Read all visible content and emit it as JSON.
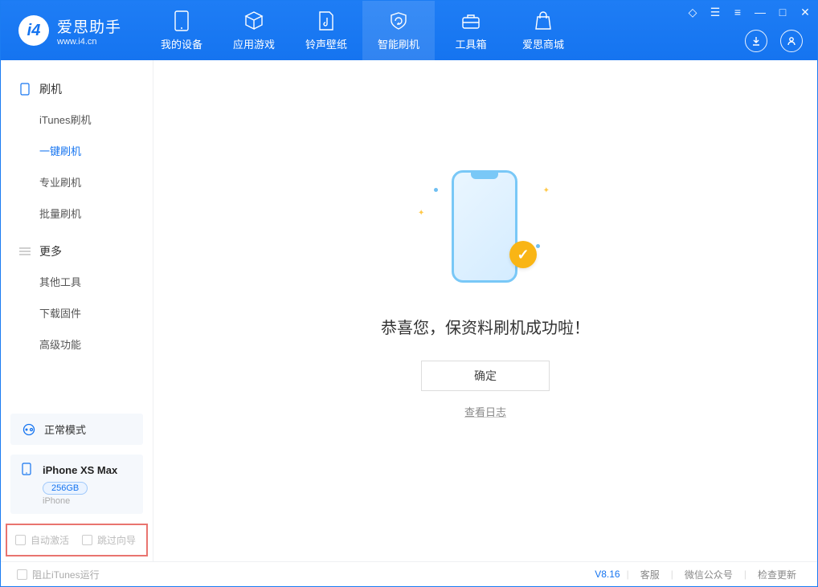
{
  "app": {
    "title": "爱思助手",
    "subtitle": "www.i4.cn"
  },
  "nav": {
    "items": [
      {
        "label": "我的设备"
      },
      {
        "label": "应用游戏"
      },
      {
        "label": "铃声壁纸"
      },
      {
        "label": "智能刷机"
      },
      {
        "label": "工具箱"
      },
      {
        "label": "爱思商城"
      }
    ]
  },
  "sidebar": {
    "section1_title": "刷机",
    "section1_items": [
      "iTunes刷机",
      "一键刷机",
      "专业刷机",
      "批量刷机"
    ],
    "section2_title": "更多",
    "section2_items": [
      "其他工具",
      "下载固件",
      "高级功能"
    ],
    "mode_card": "正常模式",
    "device": {
      "name": "iPhone XS Max",
      "capacity": "256GB",
      "type": "iPhone"
    },
    "opt_auto_activate": "自动激活",
    "opt_skip_wizard": "跳过向导"
  },
  "main": {
    "success_text": "恭喜您，保资料刷机成功啦！",
    "ok_button": "确定",
    "view_log": "查看日志"
  },
  "footer": {
    "block_itunes": "阻止iTunes运行",
    "version": "V8.16",
    "link_service": "客服",
    "link_wechat": "微信公众号",
    "link_update": "检查更新"
  }
}
